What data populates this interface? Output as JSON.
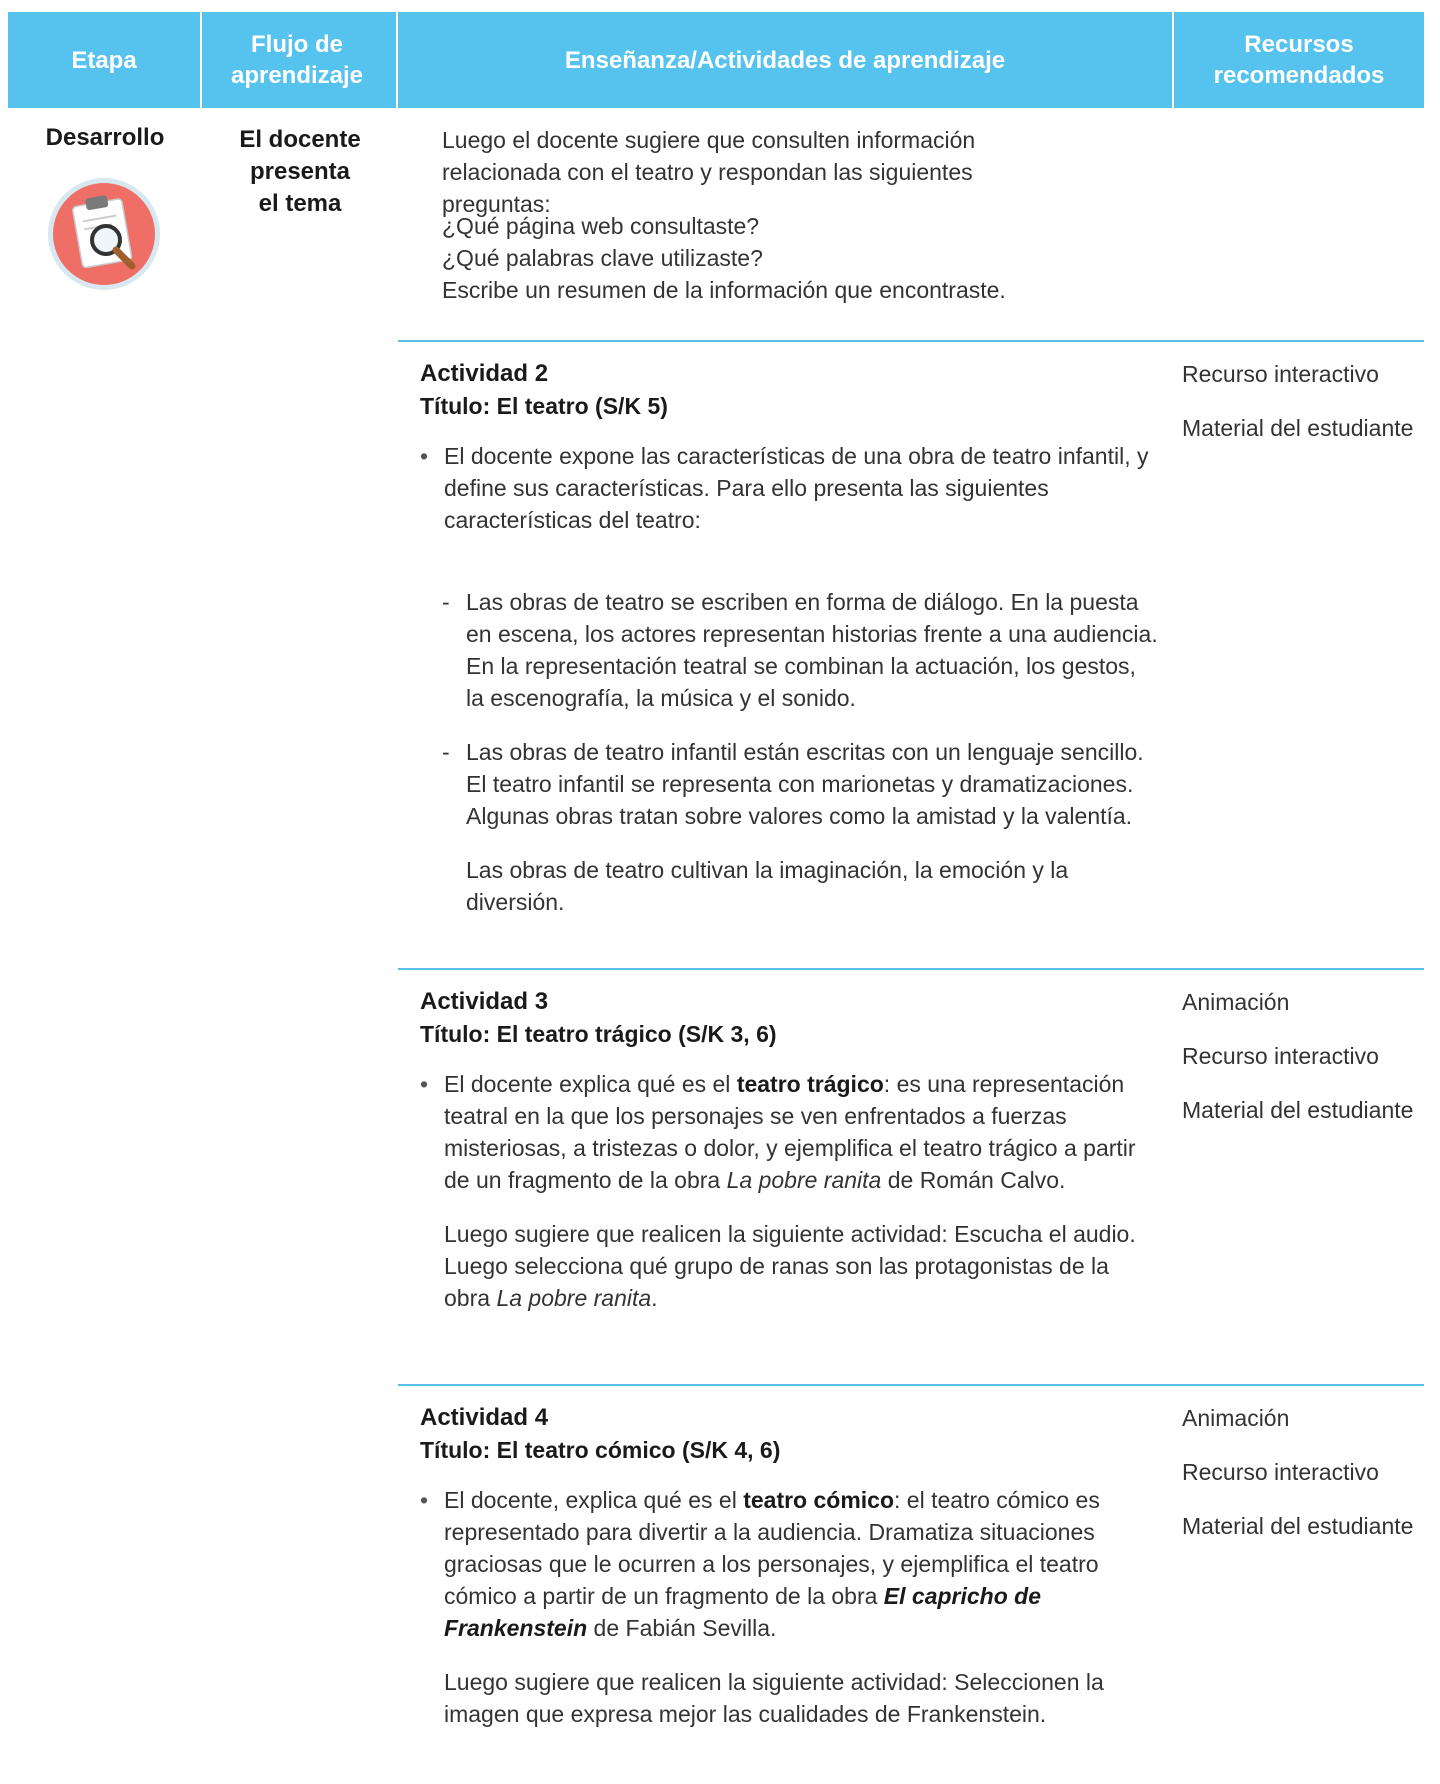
{
  "header": {
    "col1": "Etapa",
    "col2": "Flujo de aprendizaje",
    "col3": "Enseñanza/Actividades de aprendizaje",
    "col4": "Recursos recomendados"
  },
  "stage": "Desarrollo",
  "flow": "El docente\npresenta\nel tema",
  "intro": {
    "p1": "Luego el docente sugiere que consulten información relacionada con el teatro y respondan las siguientes preguntas:",
    "q1": "¿Qué página web consultaste?",
    "q2": "¿Qué palabras clave utilizaste?",
    "q3": "Escribe un resumen de la información que encontraste."
  },
  "act2": {
    "title": "Actividad 2",
    "subtitle": "Título: El teatro (S/K 5)",
    "bullet": "El docente expone las características de una obra de teatro infantil, y define sus características. Para ello presenta las siguientes características del teatro:",
    "dash1": "Las obras de teatro se escriben en forma de diálogo. En la puesta en escena, los actores representan historias frente a una audiencia. En la representación teatral se combinan la actuación, los gestos, la escenografía, la música y el sonido.",
    "dash2": "Las obras de teatro infantil están escritas con un lenguaje sencillo. El teatro infantil se representa con marionetas y dramatizaciones. Algunas obras tratan sobre valores como la amistad y la valentía.",
    "para": "Las obras de teatro cultivan la imaginación, la emoción y la diversión.",
    "resources": [
      "Recurso interactivo",
      "Material del estudiante"
    ]
  },
  "act3": {
    "title": "Actividad 3",
    "subtitle": "Título: El teatro trágico (S/K 3, 6)",
    "b_pre": "El docente explica qué es el ",
    "b_bold": "teatro trágico",
    "b_mid": ": es una representación teatral en la que los personajes se ven enfrentados a fuerzas misteriosas, a tristezas o dolor, y ejemplifica el teatro trágico a partir de un fragmento de la obra ",
    "b_ital": "La pobre ranita",
    "b_post": " de Román Calvo.",
    "p_pre": "Luego sugiere que realicen la siguiente actividad: Escucha el audio. Luego selecciona qué grupo de ranas son las protagonistas de la obra ",
    "p_ital": "La pobre ranita",
    "p_post": ".",
    "resources": [
      "Animación",
      "Recurso interactivo",
      "Material del estudiante"
    ]
  },
  "act4": {
    "title": "Actividad 4",
    "subtitle": "Título: El teatro cómico (S/K 4, 6)",
    "b_pre": "El docente, explica qué es el ",
    "b_bold": "teatro cómico",
    "b_mid": ": el teatro cómico es representado para divertir a la audiencia. Dramatiza situaciones graciosas que le ocurren a los personajes, y ejemplifica el teatro cómico a partir de un fragmento de la obra ",
    "b_ital": "El capricho de Frankenstein",
    "b_post": " de Fabián Sevilla.",
    "para": "Luego sugiere que realicen la siguiente actividad: Seleccionen la imagen que expresa mejor las cualidades de Frankenstein.",
    "resources": [
      "Animación",
      "Recurso interactivo",
      "Material del estudiante"
    ]
  }
}
